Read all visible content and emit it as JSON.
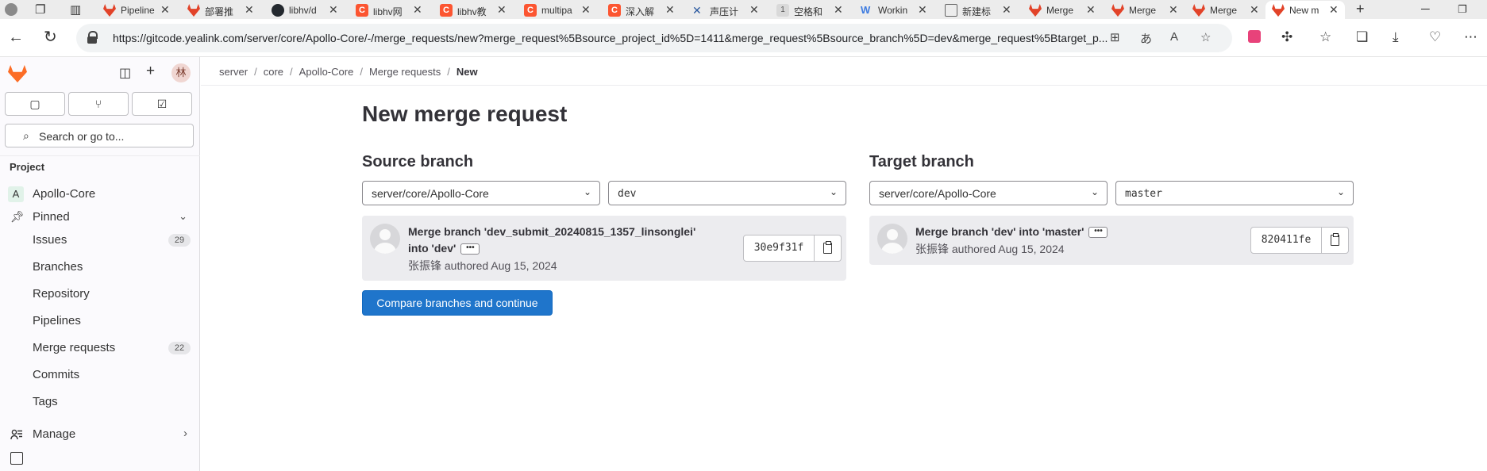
{
  "browser": {
    "tabs": [
      {
        "label": "Pipeline",
        "favicon": "gitlab-favicon"
      },
      {
        "label": "部署推",
        "favicon": "gitlab-favicon"
      },
      {
        "label": "libhv/d",
        "favicon": "github-favicon"
      },
      {
        "label": "libhv网",
        "favicon": "csdn-favicon"
      },
      {
        "label": "libhv教",
        "favicon": "csdn-favicon"
      },
      {
        "label": "multipa",
        "favicon": "csdn-favicon"
      },
      {
        "label": "深入解",
        "favicon": "csdn-favicon"
      },
      {
        "label": "声压计",
        "favicon": "tool-favicon"
      },
      {
        "label": "空格和",
        "favicon": "gray-favicon"
      },
      {
        "label": "Workin",
        "favicon": "blue-favicon"
      },
      {
        "label": "新建标",
        "favicon": "newtab-favicon"
      },
      {
        "label": "Merge",
        "favicon": "gitlab-favicon"
      },
      {
        "label": "Merge",
        "favicon": "gitlab-favicon"
      },
      {
        "label": "Merge",
        "favicon": "gitlab-favicon"
      },
      {
        "label": "New m",
        "favicon": "gitlab-favicon",
        "active": true
      }
    ],
    "url": "https://gitcode.yealink.com/server/core/Apollo-Core/-/merge_requests/new?merge_request%5Bsource_project_id%5D=1411&merge_request%5Bsource_branch%5D=dev&merge_request%5Btarget_p..."
  },
  "sidebar": {
    "avatar_text": "林",
    "search_placeholder": "Search or go to...",
    "section_heading": "Project",
    "project_initial": "A",
    "project_name": "Apollo-Core",
    "pinned_label": "Pinned",
    "items": [
      {
        "label": "Issues",
        "badge": "29"
      },
      {
        "label": "Branches",
        "badge": ""
      },
      {
        "label": "Repository",
        "badge": ""
      },
      {
        "label": "Pipelines",
        "badge": ""
      },
      {
        "label": "Merge requests",
        "badge": "22"
      },
      {
        "label": "Commits",
        "badge": ""
      },
      {
        "label": "Tags",
        "badge": ""
      }
    ],
    "manage_label": "Manage"
  },
  "breadcrumb": [
    "server",
    "core",
    "Apollo-Core",
    "Merge requests",
    "New"
  ],
  "page": {
    "title": "New merge request",
    "source": {
      "heading": "Source branch",
      "project": "server/core/Apollo-Core",
      "branch": "dev",
      "commit_title_line1": "Merge branch 'dev_submit_20240815_1357_linsonglei'",
      "commit_title_line2": "into 'dev'",
      "author": "张振锋",
      "authored_text": "authored Aug 15, 2024",
      "sha": "30e9f31f"
    },
    "target": {
      "heading": "Target branch",
      "project": "server/core/Apollo-Core",
      "branch": "master",
      "commit_title": "Merge branch 'dev' into 'master'",
      "author": "张振锋",
      "authored_text": "authored Aug 15, 2024",
      "sha": "820411fe"
    },
    "compare_button": "Compare branches and continue"
  },
  "colors": {
    "primary": "#1f75cb",
    "gitlab_orange": "#fc6d26",
    "sidebar_bg": "#fbfafd"
  }
}
